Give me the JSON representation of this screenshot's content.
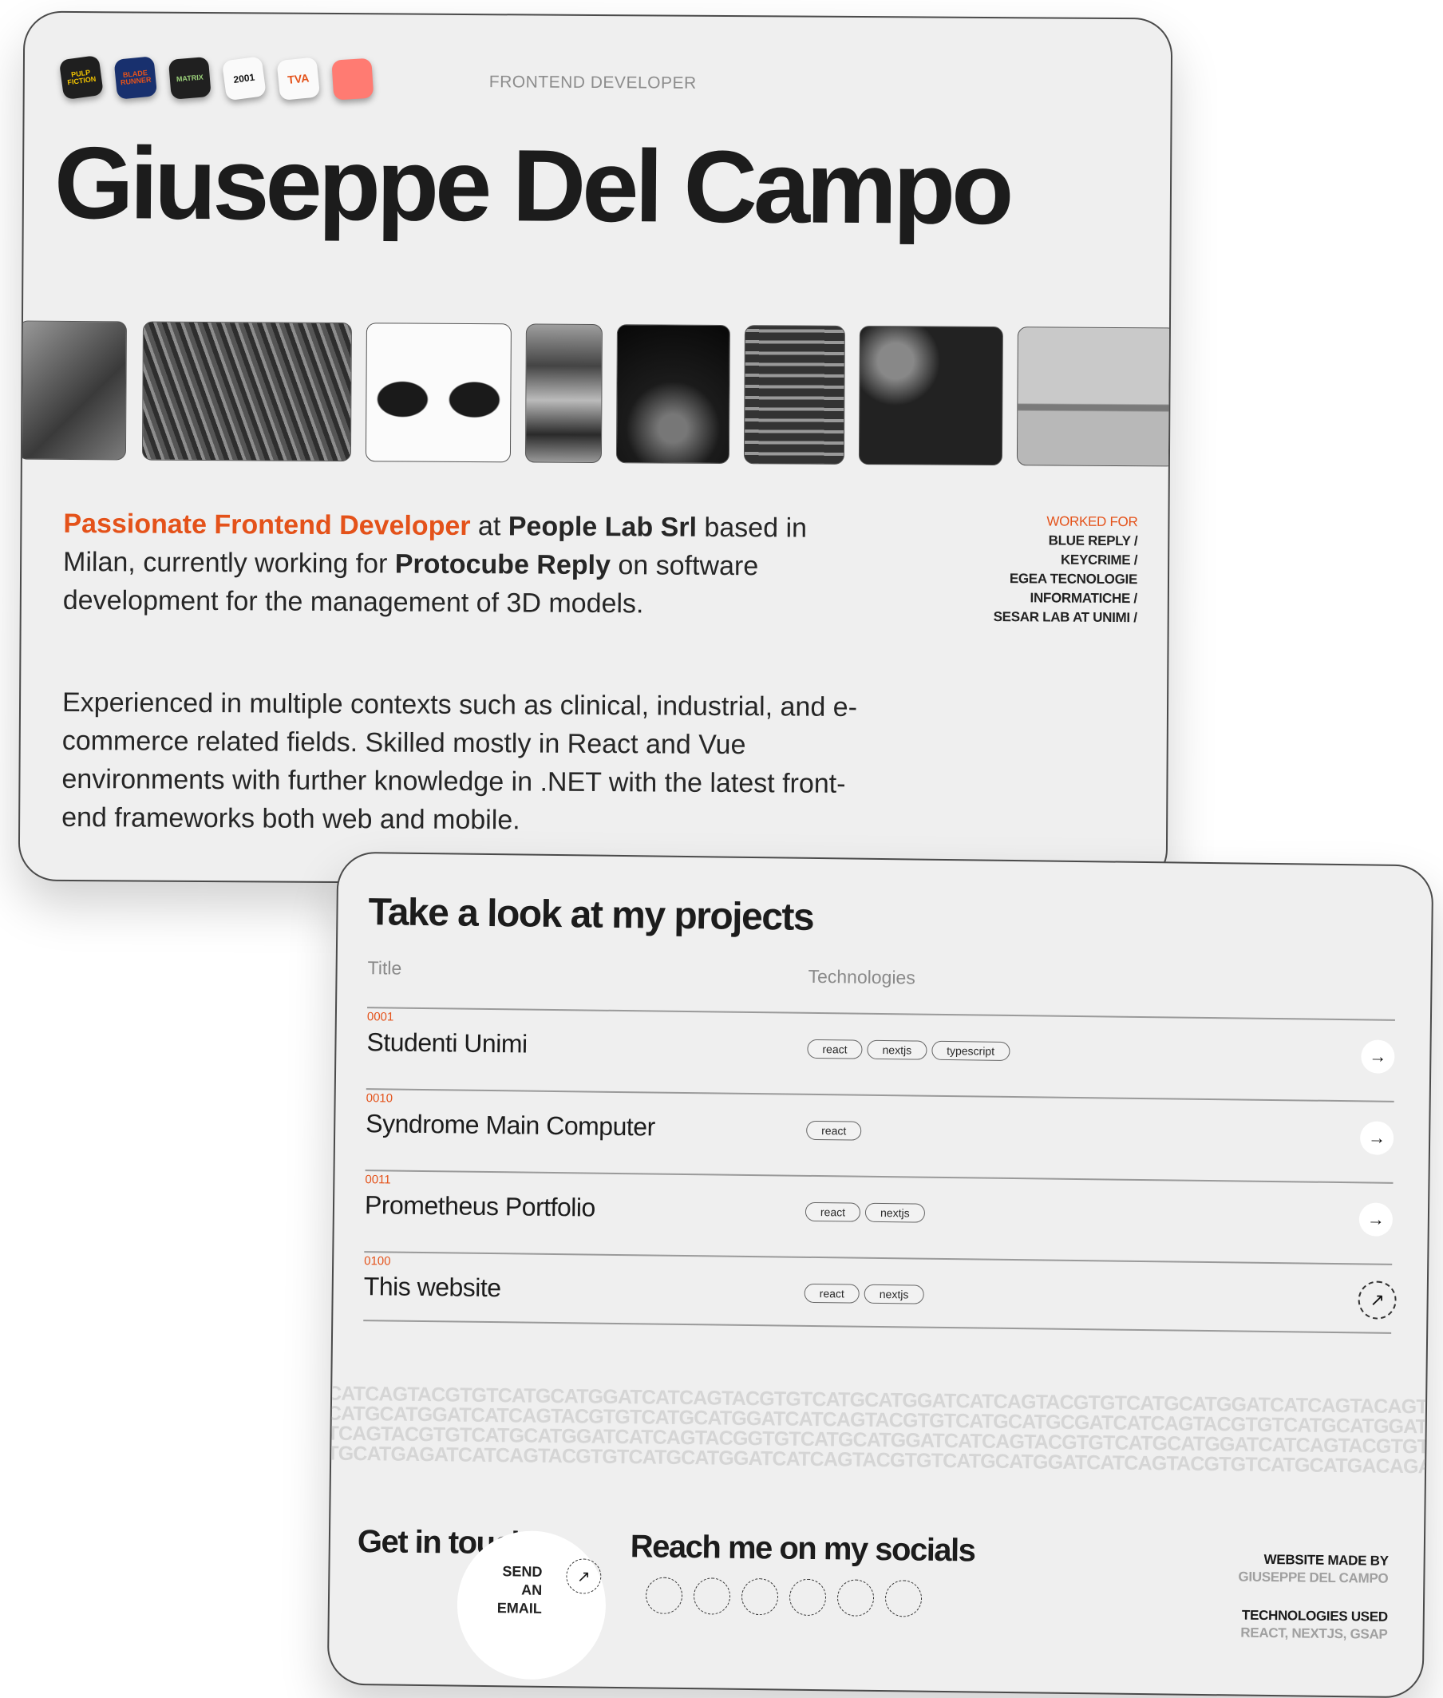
{
  "header": {
    "role": "FRONTEND DEVELOPER",
    "name": "Giuseppe Del Campo",
    "apps": [
      {
        "icon": "pulp-fiction-icon",
        "label": "PULP FICTION",
        "bg": "#1f1f1f",
        "fg": "#f2c400"
      },
      {
        "icon": "blade-runner-icon",
        "label": "BLADE RUNNER",
        "bg": "#18306e",
        "fg": "#e4521a"
      },
      {
        "icon": "matrix-icon",
        "label": "MATRIX",
        "bg": "#202020",
        "fg": "#9bd07a"
      },
      {
        "icon": "2001-icon",
        "label": "2001",
        "bg": "#fafafa",
        "fg": "#111111"
      },
      {
        "icon": "tva-icon",
        "label": "TVA",
        "bg": "#fafafa",
        "fg": "#e4521a"
      },
      {
        "icon": "coral-icon",
        "label": "",
        "bg": "#ff7b72",
        "fg": "#ff7b72"
      }
    ]
  },
  "intro": {
    "accent": "Passionate Frontend Developer",
    "t1": " at ",
    "company": "People Lab Srl",
    "t2": " based in Milan, currently working for ",
    "client": "Protocube Reply",
    "t3": " on software development for the management of 3D models."
  },
  "experience": "Experienced in multiple contexts such as clinical, industrial, and e-commerce related fields. Skilled mostly in React and Vue environments with further knowledge in .NET with the latest front-end frameworks both web and mobile.",
  "worked_for": {
    "heading": "WORKED FOR",
    "items": [
      "BLUE REPLY /",
      "KEYCRIME /",
      "EGEA TECNOLOGIE",
      "INFORMATICHE /",
      "SESAR LAB AT UNIMI /"
    ]
  },
  "projects": {
    "title": "Take a look at my projects",
    "col_title": "Title",
    "col_tech": "Technologies",
    "rows": [
      {
        "num": "0001",
        "title": "Studenti Unimi",
        "tags": [
          "react",
          "nextjs",
          "typescript"
        ],
        "arrow": "→"
      },
      {
        "num": "0010",
        "title": "Syndrome Main Computer",
        "tags": [
          "react"
        ],
        "arrow": "→"
      },
      {
        "num": "0011",
        "title": "Prometheus Portfolio",
        "tags": [
          "react",
          "nextjs"
        ],
        "arrow": "→"
      },
      {
        "num": "0100",
        "title": "This website",
        "tags": [
          "react",
          "nextjs"
        ],
        "arrow": "↗"
      }
    ]
  },
  "dna_lines": [
    "CATCAGTACGTGTCATGCATGGATCATCAGTACGTGTCATGCATGGATCATCAGTACGTGTCATGCATGGATCATCAGTACAGTGTCATGC",
    "CATGCATGGATCATCAGTACGTGTCATGCATGGATCATCAGTACGTGTCATGCATGCGATCATCAGTACGTGTCATGCATGGATCATCAGT",
    "TCAGTACGTGTCATGCATGGATCATCAGTACGGTGTCATGCATGGATCATCAGTACGTGTCATGCATGGATCATCAGTACGTGTCATGCAT",
    "TGCATGAGATCATCAGTACGTGTCATGCATGGATCATCAGTACGTGTCATGCATGGATCATCAGTACGTGTCATGCATGACAGACGTGCG"
  ],
  "contact": {
    "title": "Get in touch",
    "send": [
      "SEND",
      "AN",
      "EMAIL"
    ],
    "send_arrow": "↗"
  },
  "socials": {
    "title": "Reach me on my socials",
    "icons": [
      "social-icon-1",
      "social-icon-2",
      "social-icon-3",
      "social-icon-4",
      "social-icon-5",
      "social-icon-6"
    ]
  },
  "credits": {
    "made_label": "WEBSITE MADE BY",
    "made_value": "GIUSEPPE DEL CAMPO",
    "tech_label": "TECHNOLOGIES USED",
    "tech_value": "REACT, NEXTJS, GSAP"
  },
  "colors": {
    "accent": "#e4521a",
    "card": "#efefef"
  }
}
